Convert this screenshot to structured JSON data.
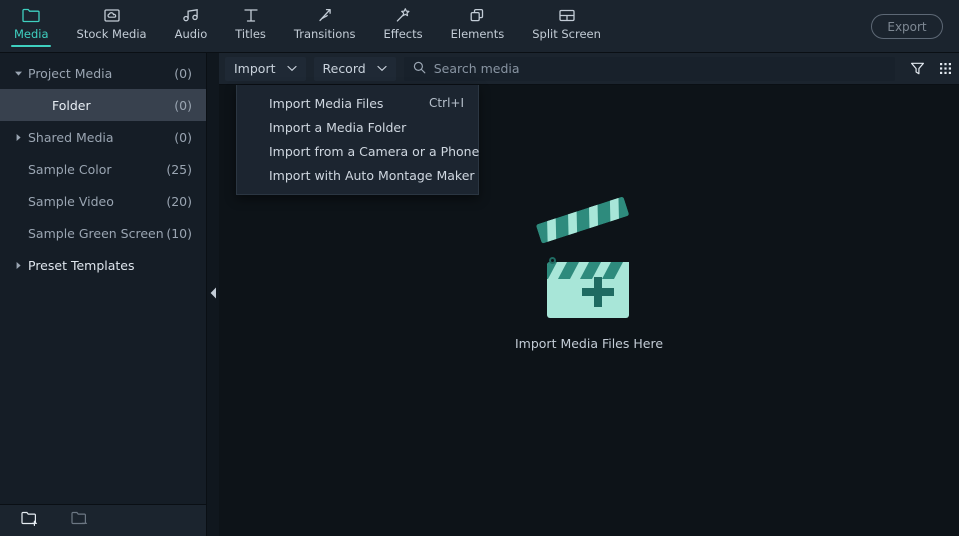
{
  "topnav": {
    "tabs": [
      {
        "label": "Media",
        "icon": "folder-icon",
        "active": true
      },
      {
        "label": "Stock Media",
        "icon": "folder-cloud-icon",
        "active": false
      },
      {
        "label": "Audio",
        "icon": "music-notes-icon",
        "active": false
      },
      {
        "label": "Titles",
        "icon": "text-t-icon",
        "active": false
      },
      {
        "label": "Transitions",
        "icon": "transition-arrow-icon",
        "active": false
      },
      {
        "label": "Effects",
        "icon": "magic-wand-icon",
        "active": false
      },
      {
        "label": "Elements",
        "icon": "stacked-squares-icon",
        "active": false
      },
      {
        "label": "Split Screen",
        "icon": "split-screen-icon",
        "active": false
      }
    ],
    "export_label": "Export"
  },
  "sidebar": {
    "items": [
      {
        "label": "Project Media",
        "count": "(0)",
        "arrow": "down",
        "indent": false,
        "selected": false,
        "bright": false
      },
      {
        "label": "Folder",
        "count": "(0)",
        "arrow": "none",
        "indent": true,
        "selected": true,
        "bright": true
      },
      {
        "label": "Shared Media",
        "count": "(0)",
        "arrow": "right",
        "indent": false,
        "selected": false,
        "bright": false
      },
      {
        "label": "Sample Color",
        "count": "(25)",
        "arrow": "none",
        "indent": false,
        "selected": false,
        "bright": false
      },
      {
        "label": "Sample Video",
        "count": "(20)",
        "arrow": "none",
        "indent": false,
        "selected": false,
        "bright": false
      },
      {
        "label": "Sample Green Screen",
        "count": "(10)",
        "arrow": "none",
        "indent": false,
        "selected": false,
        "bright": false
      },
      {
        "label": "Preset Templates",
        "count": "",
        "arrow": "right",
        "indent": false,
        "selected": false,
        "bright": true
      }
    ]
  },
  "bottombar": {
    "new_folder_icon": "folder-plus-icon",
    "remove_folder_icon": "folder-minus-icon"
  },
  "toolbar": {
    "import_label": "Import",
    "record_label": "Record",
    "search_placeholder": "Search media",
    "search_value": "",
    "filter_icon": "filter-funnel-icon",
    "grid_icon": "grid-view-icon"
  },
  "import_menu": {
    "open": true,
    "items": [
      {
        "label": "Import Media Files",
        "shortcut": "Ctrl+I"
      },
      {
        "label": "Import a Media Folder",
        "shortcut": ""
      },
      {
        "label": "Import from a Camera or a Phone",
        "shortcut": ""
      },
      {
        "label": "Import with Auto Montage Maker",
        "shortcut": ""
      }
    ]
  },
  "empty_state": {
    "label": "Import Media Files Here",
    "icon": "clapperboard-plus-icon"
  },
  "colors": {
    "accent": "#3fd0c0",
    "topnav_bg": "#1b242e",
    "sidebar_bg": "#151d26",
    "main_bg": "#0d1318",
    "selected_row": "#38414e",
    "clapper_light": "#a8e6d8",
    "clapper_dark": "#2e8b7d"
  }
}
